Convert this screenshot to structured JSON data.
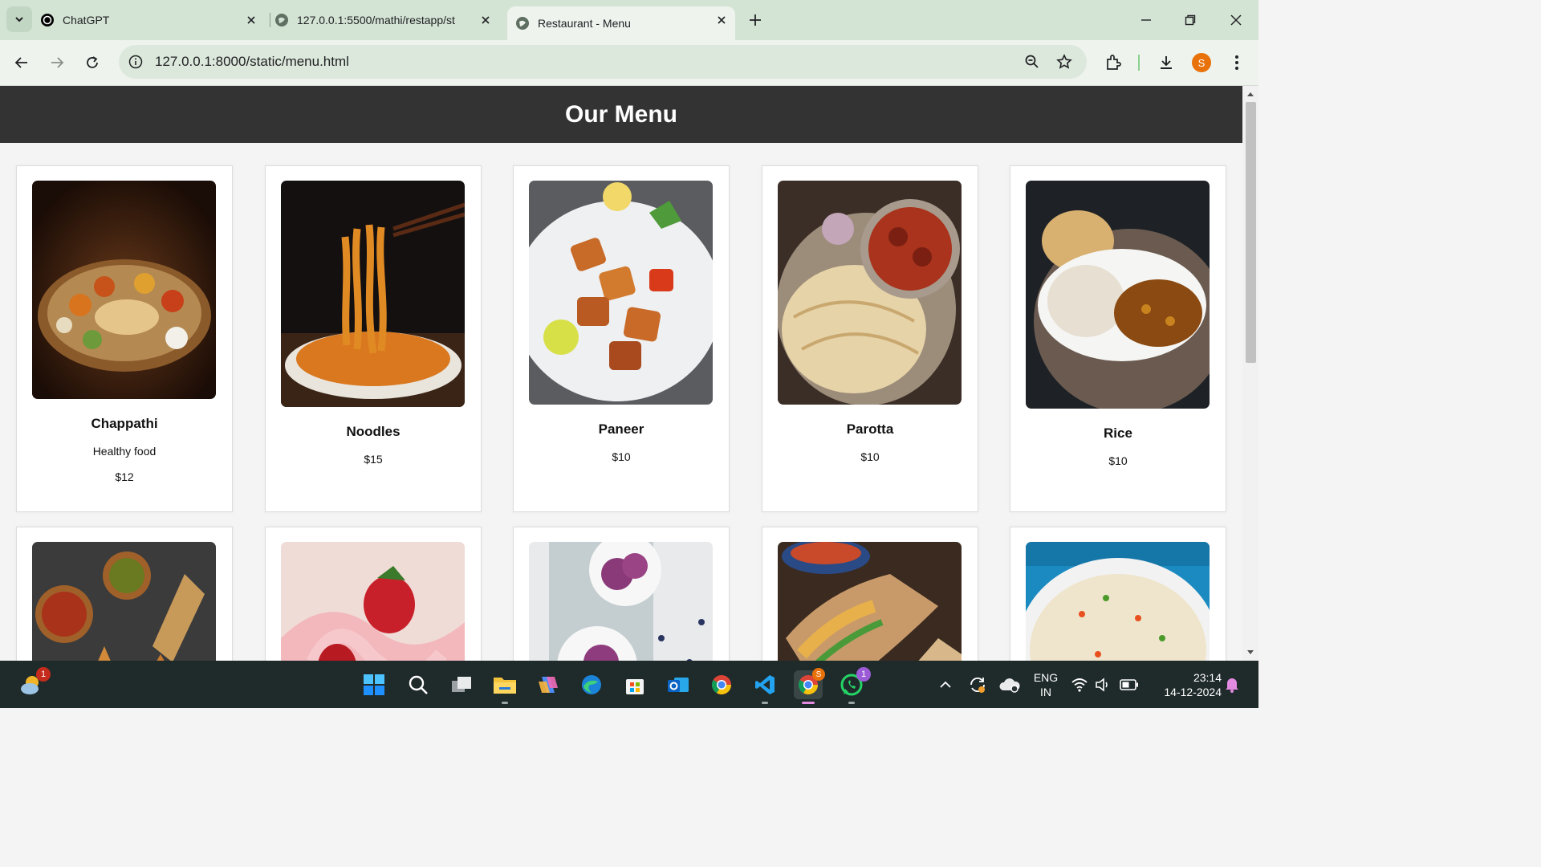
{
  "browser": {
    "tabs": [
      {
        "title": "ChatGPT",
        "favicon": "chatgpt-icon"
      },
      {
        "title": "127.0.0.1:5500/mathi/restapp/st",
        "favicon": "globe-icon"
      },
      {
        "title": "Restaurant - Menu",
        "favicon": "globe-icon",
        "active": true
      }
    ],
    "url": "127.0.0.1:8000/static/menu.html",
    "profile_initial": "S",
    "accent": "#d3e3d4"
  },
  "page": {
    "title": "Our Menu",
    "items": [
      {
        "name": "Chappathi",
        "description": "Healthy food",
        "price": "$12"
      },
      {
        "name": "Noodles",
        "price": "$15"
      },
      {
        "name": "Paneer",
        "price": "$10"
      },
      {
        "name": "Parotta",
        "price": "$10"
      },
      {
        "name": "Rice",
        "price": "$10"
      },
      {
        "name": "",
        "price": ""
      },
      {
        "name": "",
        "price": ""
      },
      {
        "name": "",
        "price": ""
      },
      {
        "name": "",
        "price": ""
      },
      {
        "name": "",
        "price": ""
      }
    ]
  },
  "taskbar": {
    "weather_badge": "1",
    "chrome_badge": "S",
    "whatsapp_badge": "1",
    "language": "ENG",
    "region": "IN",
    "time": "23:14",
    "date": "14-12-2024"
  }
}
